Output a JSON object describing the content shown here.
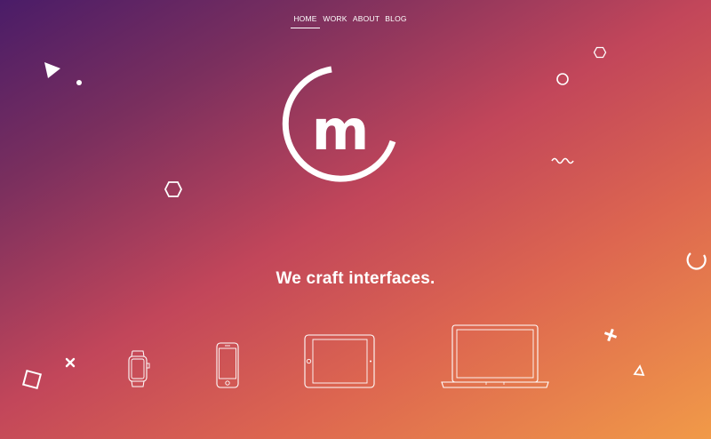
{
  "nav": {
    "items": [
      {
        "id": "home",
        "label": "HOME",
        "active": true
      },
      {
        "id": "work",
        "label": "WORK"
      },
      {
        "id": "about",
        "label": "ABOUT"
      },
      {
        "id": "blog",
        "label": "BLOG"
      }
    ]
  },
  "logo": {
    "letter": "m"
  },
  "hero": {
    "tagline": "We craft interfaces."
  },
  "devices": [
    "watch-icon",
    "phone-icon",
    "tablet-icon",
    "laptop-icon"
  ],
  "colors": {
    "gradient_start": "#4a1c68",
    "gradient_mid": "#c2465a",
    "gradient_end": "#f19a48",
    "foreground": "#ffffff"
  }
}
